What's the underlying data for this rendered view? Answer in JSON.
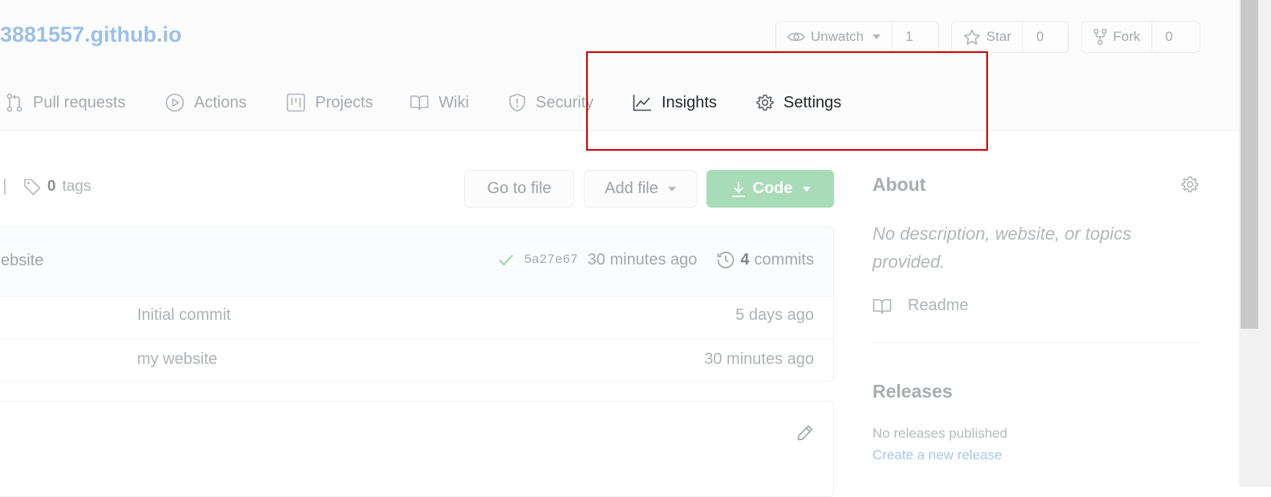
{
  "repo": {
    "name": "3881557.github.io"
  },
  "header_buttons": {
    "watch": {
      "label": "Unwatch",
      "count": "1"
    },
    "star": {
      "label": "Star",
      "count": "0"
    },
    "fork": {
      "label": "Fork",
      "count": "0"
    }
  },
  "tabs": [
    {
      "label": "Pull requests",
      "icon": "pull-request-icon"
    },
    {
      "label": "Actions",
      "icon": "play-icon"
    },
    {
      "label": "Projects",
      "icon": "project-icon"
    },
    {
      "label": "Wiki",
      "icon": "book-icon"
    },
    {
      "label": "Security",
      "icon": "shield-icon"
    },
    {
      "label": "Insights",
      "icon": "graph-icon"
    },
    {
      "label": "Settings",
      "icon": "gear-icon"
    }
  ],
  "meta": {
    "tags_count": "0",
    "tags_label": "tags"
  },
  "actions": {
    "go_to_file": "Go to file",
    "add_file": "Add file",
    "code": "Code"
  },
  "latest_commit": {
    "message": "ebsite",
    "sha": "5a27e67",
    "time": "30 minutes ago",
    "commits_count": "4",
    "commits_label": "commits"
  },
  "files": [
    {
      "message": "Initial commit",
      "age": "5 days ago"
    },
    {
      "message": "my website",
      "age": "30 minutes ago"
    }
  ],
  "about": {
    "title": "About",
    "description": "No description, website, or topics provided.",
    "readme_label": "Readme"
  },
  "releases": {
    "title": "Releases",
    "none_text": "No releases published",
    "create_link": "Create a new release"
  },
  "colors": {
    "link": "#9cc0e6",
    "code_button": "#a8dbb8",
    "highlight": "#d00000"
  }
}
